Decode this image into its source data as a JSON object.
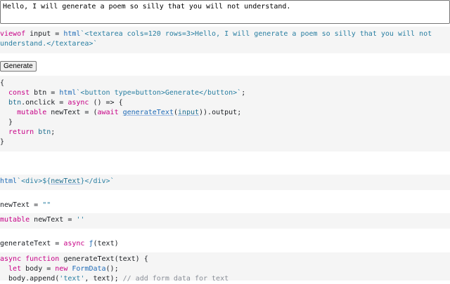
{
  "textarea": {
    "value": "Hello, I will generate a poem so silly that you will not understand."
  },
  "cell_viewof": {
    "kw": "viewof",
    "name": " input = ",
    "fn": "html",
    "str1": "`<textarea cols=120 rows=3>Hello, I will generate a poem so silly that you will not",
    "str2": "understand.</textarea>`"
  },
  "generate_button": {
    "label": "Generate"
  },
  "cell_btn": {
    "l1": "{",
    "l2_kw": "  const",
    "l2_a": " btn = ",
    "l2_fn": "html",
    "l2_str": "`<button type=button>Generate</button>`",
    "l2_end": ";",
    "l3_var": "  btn",
    "l3_a": ".onclick = ",
    "l3_kw": "async",
    "l3_b": " () => {",
    "l4_kw1": "    mutable",
    "l4_a": " newText = (",
    "l4_kw2": "await",
    "l4_sp": " ",
    "l4_fn": "generateText",
    "l4_b": "(",
    "l4_var": "input",
    "l4_c": ")).output;",
    "l5": "  }",
    "l6_kw": "  return",
    "l6_var": " btn",
    "l6_end": ";",
    "l7": "}"
  },
  "cell_div": {
    "fn": "html",
    "str_a": "`<div>${",
    "var": "newText",
    "str_b": "}</div>`"
  },
  "cell_newtext": {
    "a": "newText = ",
    "str": "\"\""
  },
  "cell_mutable": {
    "kw": "mutable",
    "a": " newText = ",
    "str": "''"
  },
  "cell_gen": {
    "a": "generateText = ",
    "kw": "async",
    "sp": " ",
    "fn": "ƒ",
    "b": "(text)"
  },
  "cell_func": {
    "l1_kw": "async function",
    "l1_a": " generateText(text) {",
    "l2_kw": "  let",
    "l2_a": " body = ",
    "l2_kw2": "new",
    "l2_fn": " FormData",
    "l2_b": "();",
    "l3_a": "  body.append(",
    "l3_str": "'text'",
    "l3_b": ", text); ",
    "l3_cm": "// add form data for text"
  }
}
